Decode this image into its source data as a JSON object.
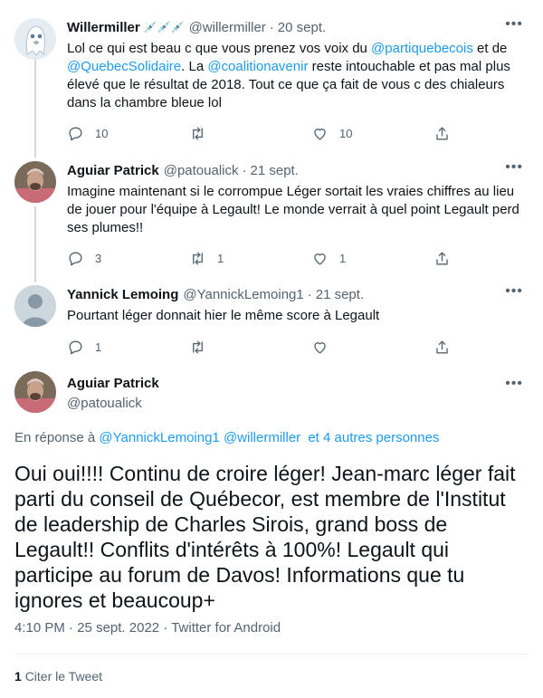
{
  "tweets": [
    {
      "name": "Willermiller",
      "name_emoji": "💉💉💉",
      "handle": "@willermiller",
      "dot": "·",
      "date": "20 sept.",
      "text_parts": [
        "Lol ce qui est beau c que vous prenez vos voix du ",
        "@partiquebecois",
        " et de ",
        "@QuebecSolidaire",
        ". La ",
        "@coalitionavenir",
        " reste intouchable et pas mal plus élevé que le résultat de 2018. Tout ce que ça fait de vous c des chialeurs dans la chambre bleue lol"
      ],
      "replies": "10",
      "retweets": "",
      "likes": "10",
      "avatar": "ghost-avatar"
    },
    {
      "name": "Aguiar Patrick",
      "handle": "@patoualick",
      "dot": "·",
      "date": "21 sept.",
      "text": "Imagine maintenant si le corrompue Léger sortait les vraies chiffres au lieu de jouer pour l'équipe à Legault! Le monde verrait à quel point Legault perd ses plumes!!",
      "replies": "3",
      "retweets": "1",
      "likes": "1",
      "avatar": "photo-avatar"
    },
    {
      "name": "Yannick Lemoing",
      "handle": "@YannickLemoing1",
      "dot": "·",
      "date": "21 sept.",
      "text": "Pourtant léger donnait hier le même score à Legault",
      "replies": "1",
      "retweets": "",
      "likes": "",
      "avatar": "default-avatar"
    }
  ],
  "main_tweet": {
    "name": "Aguiar Patrick",
    "handle": "@patoualick",
    "reply_prefix": "En réponse à ",
    "reply_mention1": "@YannickLemoing1",
    "reply_mention2": "@willermiller",
    "reply_others": "et 4 autres personnes",
    "text": "Oui oui!!!! Continu de croire léger! Jean-marc léger fait parti du conseil de Québecor, est membre de l'Institut de leadership de Charles Sirois, grand boss de Legault!! Conflits d'intérêts à 100%! Legault qui participe au forum de Davos! Informations que tu ignores et beaucoup+",
    "time": "4:10 PM",
    "date": "25 sept. 2022",
    "source": "Twitter for Android",
    "meta_sep": "·",
    "quote_count": "1",
    "quote_label": "Citer le Tweet"
  },
  "colors": {
    "link": "#1d9bf0",
    "muted": "#536471",
    "text": "#0f1419",
    "line": "#cfd9de"
  },
  "icons": [
    "reply-icon",
    "retweet-icon",
    "like-icon",
    "share-icon",
    "more-icon"
  ]
}
